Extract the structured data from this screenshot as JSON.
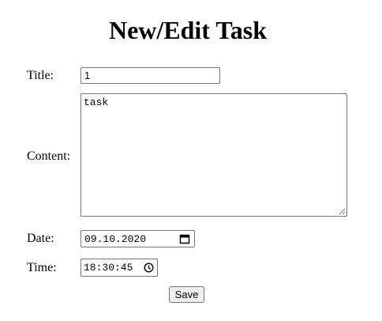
{
  "page": {
    "title": "New/Edit Task"
  },
  "form": {
    "title_label": "Title:",
    "title_value": "1",
    "content_label": "Content:",
    "content_value": "task",
    "date_label": "Date:",
    "date_value": "09.10.2020",
    "date_icon": "calendar-icon",
    "time_label": "Time:",
    "time_value": "18:30:45",
    "time_icon": "clock-icon",
    "save_label": "Save"
  }
}
